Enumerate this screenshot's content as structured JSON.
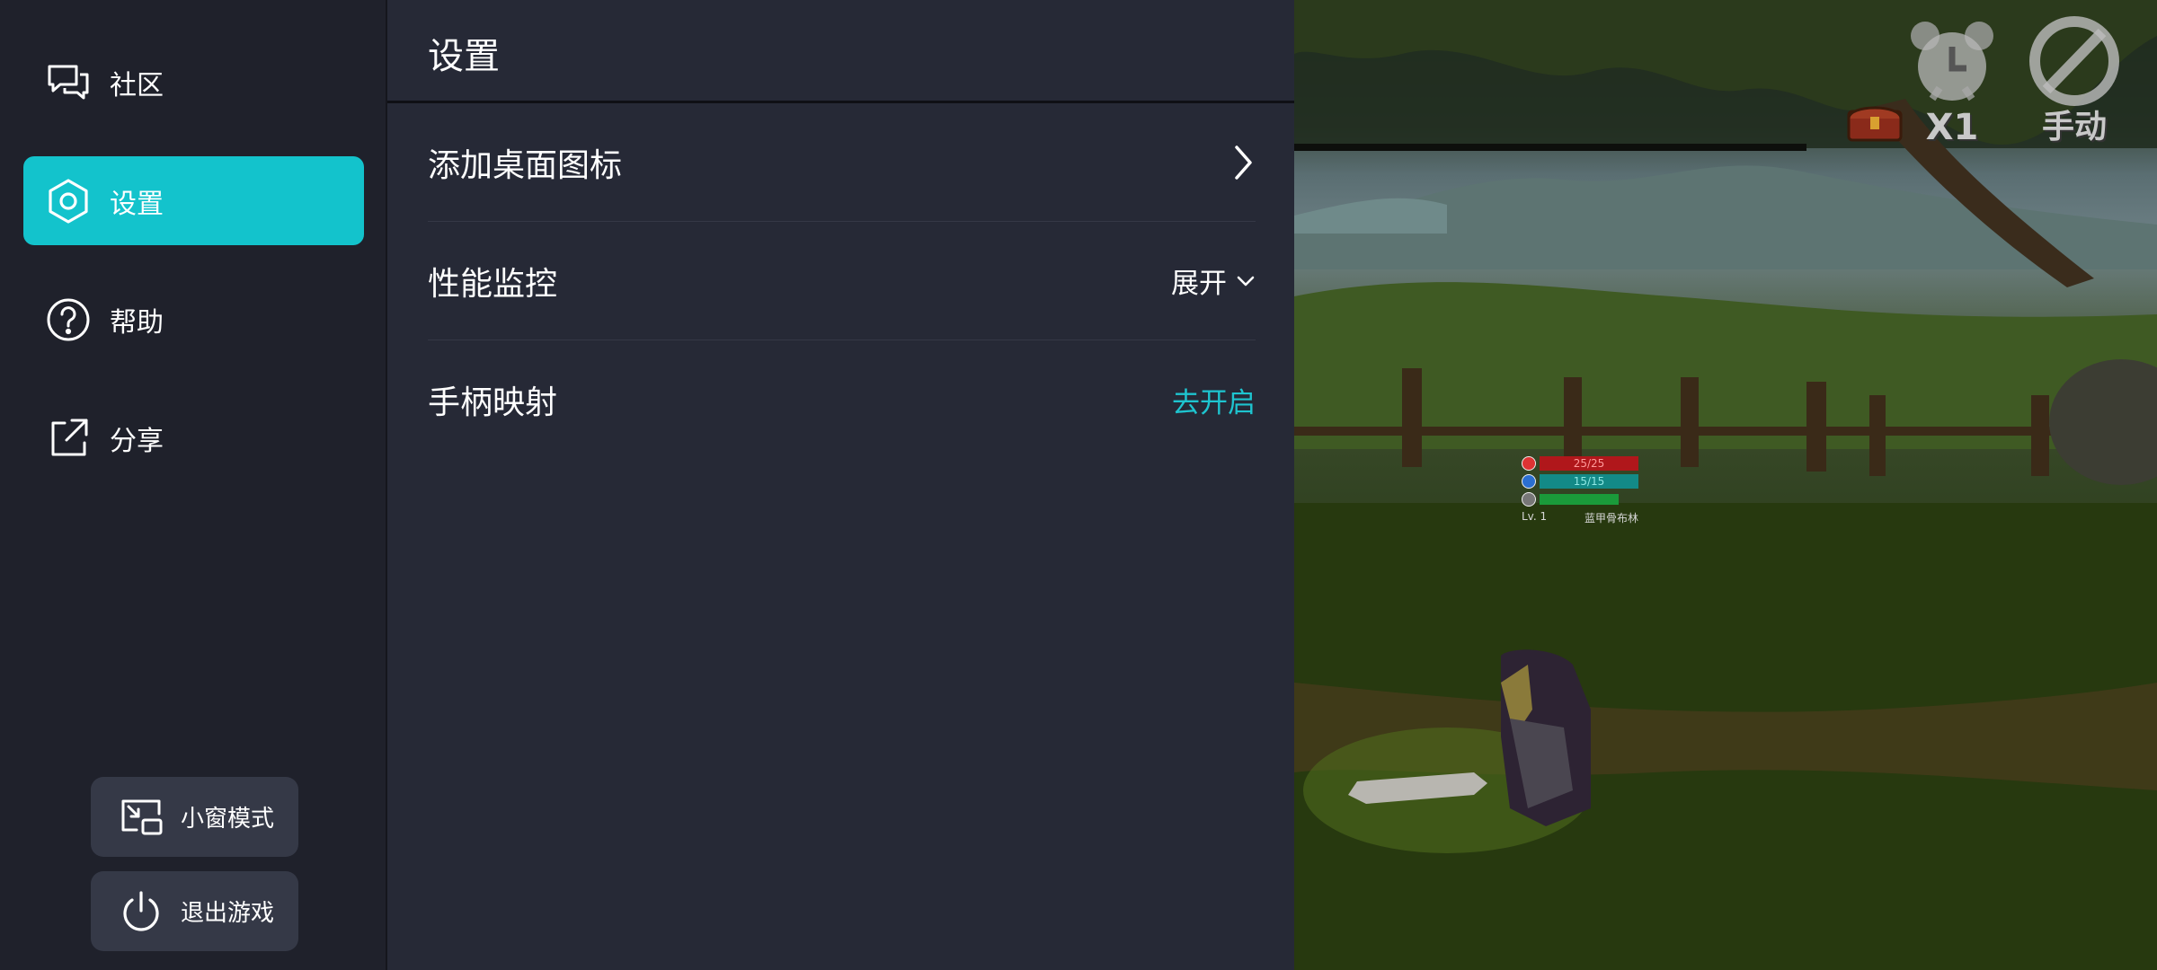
{
  "sidebar": {
    "items": [
      {
        "label": "社区",
        "icon": "chat-bubbles-icon"
      },
      {
        "label": "设置",
        "icon": "hexagon-settings-icon",
        "active": true
      },
      {
        "label": "帮助",
        "icon": "question-circle-icon"
      },
      {
        "label": "分享",
        "icon": "share-external-icon"
      }
    ],
    "bottom_buttons": [
      {
        "label": "小窗模式",
        "icon": "picture-in-picture-icon"
      },
      {
        "label": "退出游戏",
        "icon": "power-icon"
      }
    ]
  },
  "settings": {
    "title": "设置",
    "rows": [
      {
        "label": "添加桌面图标",
        "action": "chevron-right-icon"
      },
      {
        "label": "性能监控",
        "value": "展开"
      },
      {
        "label": "手柄映射",
        "value": "去开启"
      }
    ]
  },
  "game": {
    "speed_label": "X1",
    "manual_label": "手动",
    "hp_text": "25/25",
    "mp_text": "15/15",
    "level_text": "Lv. 1",
    "enemy_name": "蓝甲骨布林"
  },
  "colors": {
    "accent": "#13c3cc",
    "accent_text": "#1ec4cf",
    "sidebar_bg": "#1f212b",
    "panel_bg": "#262936",
    "button_bg": "#353947"
  }
}
